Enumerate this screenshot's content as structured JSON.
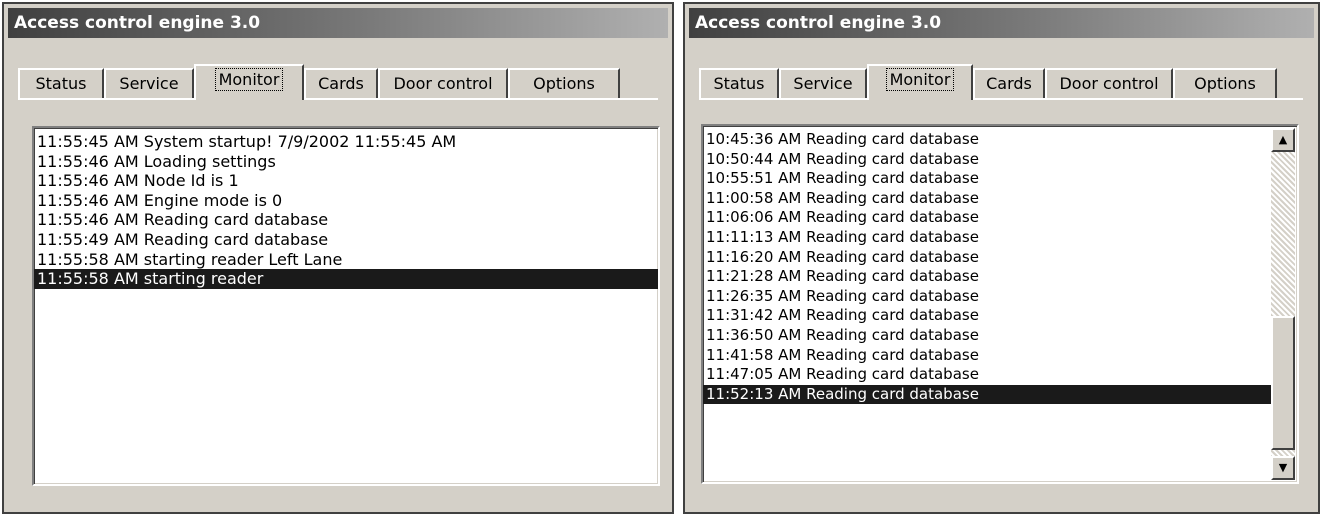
{
  "left_window": {
    "title": "Access control engine 3.0",
    "tabs": [
      "Status",
      "Service",
      "Monitor",
      "Cards",
      "Door control",
      "Options"
    ],
    "active_tab": "Monitor",
    "log": [
      "11:55:45 AM System startup! 7/9/2002 11:55:45 AM",
      "11:55:46 AM Loading settings",
      "11:55:46 AM Node Id is 1",
      "11:55:46 AM Engine mode is 0",
      "11:55:46 AM Reading card database",
      "11:55:49 AM Reading card database",
      "11:55:58 AM starting reader Left Lane",
      "11:55:58 AM starting reader"
    ],
    "selected_index": 7
  },
  "right_window": {
    "title": "Access control engine 3.0",
    "tabs": [
      "Status",
      "Service",
      "Monitor",
      "Cards",
      "Door control",
      "Options"
    ],
    "active_tab": "Monitor",
    "log": [
      "10:45:36 AM Reading card database",
      "10:50:44 AM Reading card database",
      "10:55:51 AM Reading card database",
      "11:00:58 AM Reading card database",
      "11:06:06 AM Reading card database",
      "11:11:13 AM Reading card database",
      "11:16:20 AM Reading card database",
      "11:21:28 AM Reading card database",
      "11:26:35 AM Reading card database",
      "11:31:42 AM Reading card database",
      "11:36:50 AM Reading card database",
      "11:41:58 AM Reading card database",
      "11:47:05 AM Reading card database",
      "11:52:13 AM Reading card database"
    ],
    "selected_index": 13,
    "scrollbar": {
      "up_icon": "scroll-up-arrow-icon",
      "down_icon": "scroll-down-arrow-icon"
    }
  }
}
